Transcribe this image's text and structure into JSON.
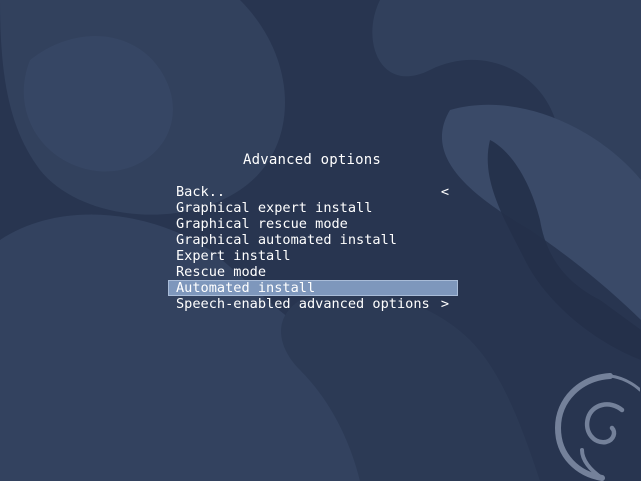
{
  "screen": {
    "title": "Advanced options",
    "background_color": "#283550",
    "highlight_color": "#7e97bc"
  },
  "menu": {
    "items": [
      {
        "label": "Back..",
        "arrow": "<",
        "selected": false
      },
      {
        "label": "Graphical expert install",
        "arrow": "",
        "selected": false
      },
      {
        "label": "Graphical rescue mode",
        "arrow": "",
        "selected": false
      },
      {
        "label": "Graphical automated install",
        "arrow": "",
        "selected": false
      },
      {
        "label": "Expert install",
        "arrow": "",
        "selected": false
      },
      {
        "label": "Rescue mode",
        "arrow": "",
        "selected": false
      },
      {
        "label": "Automated install",
        "arrow": "",
        "selected": true
      },
      {
        "label": "Speech-enabled advanced options",
        "arrow": ">",
        "selected": false
      }
    ]
  },
  "branding": {
    "logo_icon": "debian-swirl-icon"
  }
}
